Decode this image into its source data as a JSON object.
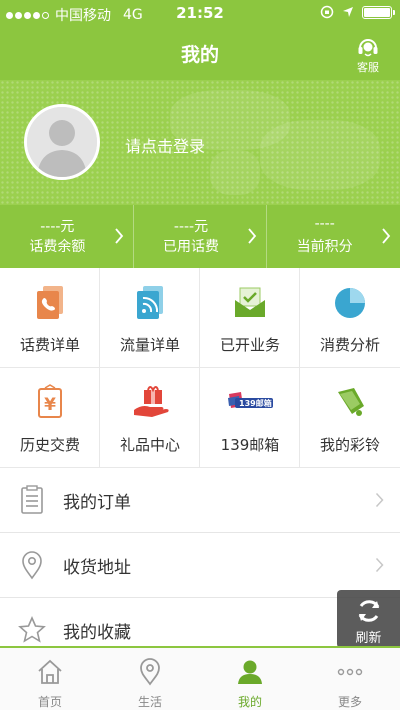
{
  "status_bar": {
    "carrier": "中国移动",
    "network": "4G",
    "time": "21:52"
  },
  "header": {
    "title": "我的",
    "service_label": "客服"
  },
  "profile": {
    "login_prompt": "请点击登录"
  },
  "stats": [
    {
      "value": "----元",
      "label": "话费余额"
    },
    {
      "value": "----元",
      "label": "已用话费"
    },
    {
      "value": "----",
      "label": "当前积分"
    }
  ],
  "grid": [
    {
      "label": "话费详单",
      "icon": "phone-bill-icon"
    },
    {
      "label": "流量详单",
      "icon": "data-usage-icon"
    },
    {
      "label": "已开业务",
      "icon": "opened-services-icon"
    },
    {
      "label": "消费分析",
      "icon": "pie-chart-icon"
    },
    {
      "label": "历史交费",
      "icon": "payment-history-icon"
    },
    {
      "label": "礼品中心",
      "icon": "gift-icon"
    },
    {
      "label": "139邮箱",
      "icon": "mailbox-139-icon"
    },
    {
      "label": "我的彩铃",
      "icon": "ringtone-bell-icon"
    }
  ],
  "list": [
    {
      "label": "我的订单",
      "icon": "order-list-icon"
    },
    {
      "label": "收货地址",
      "icon": "location-pin-icon"
    },
    {
      "label": "我的收藏",
      "icon": "star-icon"
    }
  ],
  "refresh_label": "刷新",
  "tabs": [
    {
      "label": "首页",
      "icon": "home-icon"
    },
    {
      "label": "生活",
      "icon": "location-icon"
    },
    {
      "label": "我的",
      "icon": "user-icon",
      "active": true
    },
    {
      "label": "更多",
      "icon": "more-icon"
    }
  ],
  "colors": {
    "brand_green": "#8cc63f",
    "active_tab": "#6aa92a"
  }
}
